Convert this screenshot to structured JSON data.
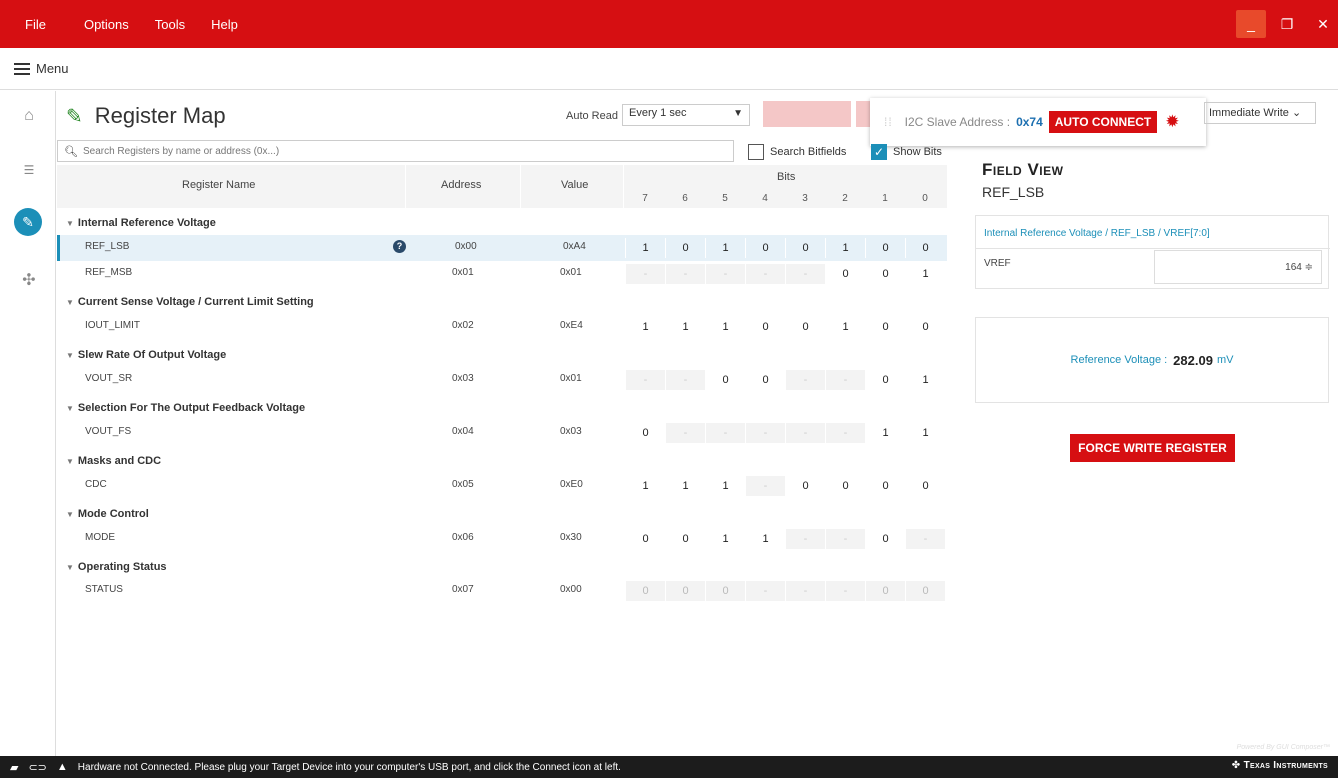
{
  "titlebar": {
    "menu": [
      "File",
      "Options",
      "Tools",
      "Help"
    ],
    "controls": {
      "minimize": "_",
      "restore": "❐",
      "close": "✕"
    }
  },
  "menubar": {
    "label": "Menu"
  },
  "nav": {
    "icons": [
      "home-icon",
      "sliders-icon",
      "pencil-icon",
      "puzzle-icon"
    ]
  },
  "header": {
    "title": "Register Map",
    "autoread_label": "Auto Read",
    "autoread_value": "Every 1 sec",
    "i2c_label": "I2C Slave Address :",
    "i2c_address": "0x74",
    "auto_connect": "AUTO CONNECT",
    "write_mode": "Immediate Write"
  },
  "search": {
    "placeholder": "Search Registers by name or address (0x...)",
    "search_bitfields": "Search Bitfields",
    "show_bits": "Show Bits"
  },
  "table": {
    "columns": {
      "name": "Register Name",
      "address": "Address",
      "value": "Value",
      "bits": "Bits"
    },
    "bit_labels": [
      "7",
      "6",
      "5",
      "4",
      "3",
      "2",
      "1",
      "0"
    ],
    "groups": [
      {
        "name": "Internal Reference Voltage"
      },
      {
        "name": "Current Sense Voltage / Current Limit Setting"
      },
      {
        "name": "Slew Rate Of Output Voltage"
      },
      {
        "name": "Selection For The Output Feedback Voltage"
      },
      {
        "name": "Masks and CDC"
      },
      {
        "name": "Mode Control"
      },
      {
        "name": "Operating Status"
      }
    ],
    "rows": [
      {
        "name": "REF_LSB",
        "address": "0x00",
        "value": "0xA4",
        "bits": [
          "1",
          "0",
          "1",
          "0",
          "0",
          "1",
          "0",
          "0"
        ]
      },
      {
        "name": "REF_MSB",
        "address": "0x01",
        "value": "0x01",
        "bits": [
          "-",
          "-",
          "-",
          "-",
          "-",
          "0",
          "0",
          "1"
        ]
      },
      {
        "name": "IOUT_LIMIT",
        "address": "0x02",
        "value": "0xE4",
        "bits": [
          "1",
          "1",
          "1",
          "0",
          "0",
          "1",
          "0",
          "0"
        ]
      },
      {
        "name": "VOUT_SR",
        "address": "0x03",
        "value": "0x01",
        "bits": [
          "-",
          "-",
          "0",
          "0",
          "-",
          "-",
          "0",
          "1"
        ]
      },
      {
        "name": "VOUT_FS",
        "address": "0x04",
        "value": "0x03",
        "bits": [
          "0",
          "-",
          "-",
          "-",
          "-",
          "-",
          "1",
          "1"
        ]
      },
      {
        "name": "CDC",
        "address": "0x05",
        "value": "0xE0",
        "bits": [
          "1",
          "1",
          "1",
          "-",
          "0",
          "0",
          "0",
          "0"
        ]
      },
      {
        "name": "MODE",
        "address": "0x06",
        "value": "0x30",
        "bits": [
          "0",
          "0",
          "1",
          "1",
          "-",
          "-",
          "0",
          "-"
        ]
      },
      {
        "name": "STATUS",
        "address": "0x07",
        "value": "0x00",
        "bits": [
          "0",
          "0",
          "0",
          "-",
          "-",
          "-",
          "0",
          "0"
        ]
      }
    ]
  },
  "field_view": {
    "title": "Field View",
    "register": "REF_LSB",
    "path": "Internal Reference Voltage / REF_LSB / VREF[7:0]",
    "field_name": "VREF",
    "field_value": "164 ≑",
    "ref_label": "Reference Voltage :",
    "ref_value": "282.09",
    "ref_unit": "mV",
    "force_write": "FORCE WRITE REGISTER"
  },
  "status": {
    "message": "Hardware not Connected.   Please plug your Target Device into your computer's USB port, and click the Connect icon at left.",
    "brand": "Texas Instruments",
    "powered": "Powered By GUI Composer™"
  },
  "colors": {
    "accent": "#d60f12",
    "link": "#1c8fb8"
  }
}
